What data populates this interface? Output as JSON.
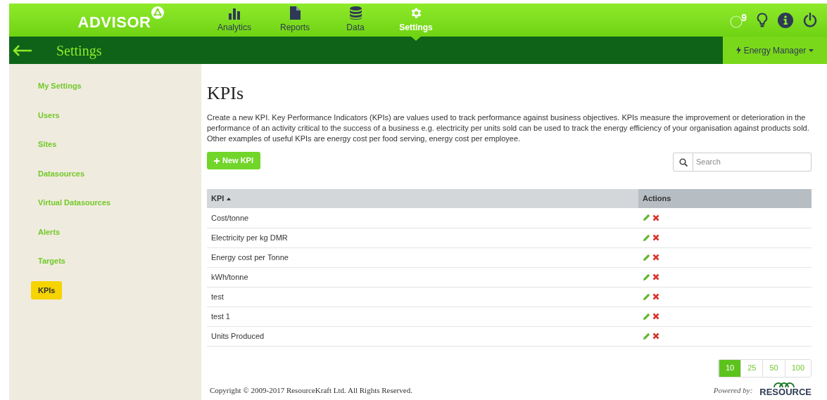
{
  "header": {
    "logo": "ADVISOR",
    "nav": [
      {
        "label": "Analytics",
        "selected": false
      },
      {
        "label": "Reports",
        "selected": false
      },
      {
        "label": "Data",
        "selected": false
      },
      {
        "label": "Settings",
        "selected": true
      }
    ],
    "badge": "9"
  },
  "subheader": {
    "title": "Settings",
    "role": "Energy Manager"
  },
  "sidebar": {
    "items": [
      {
        "label": "My Settings",
        "selected": false
      },
      {
        "label": "Users",
        "selected": false
      },
      {
        "label": "Sites",
        "selected": false
      },
      {
        "label": "Datasources",
        "selected": false
      },
      {
        "label": "Virtual Datasources",
        "selected": false
      },
      {
        "label": "Alerts",
        "selected": false
      },
      {
        "label": "Targets",
        "selected": false
      },
      {
        "label": "KPIs",
        "selected": true
      }
    ]
  },
  "page": {
    "title": "KPIs",
    "description": [
      "Create a new KPI. Key Performance Indicators (KPIs) are values used to track performance against business objectives. KPIs measure the improvement or deterioration in the performance of an activity critical to the success of a business e.g. electricity per units sold can be used to track the energy efficiency of your organisation against products sold.",
      "Other examples of useful KPIs are energy cost per food serving, energy cost per employee."
    ],
    "new_button": "New KPI",
    "search": {
      "placeholder": "Search"
    }
  },
  "table": {
    "columns": [
      "KPI",
      "Actions"
    ],
    "rows": [
      "Cost/tonne",
      "Electricity per kg DMR",
      "Energy cost per Tonne",
      "kWh/tonne",
      "test",
      "test 1",
      "Units Produced"
    ]
  },
  "page_sizes": [
    {
      "label": "10",
      "selected": true
    },
    {
      "label": "25",
      "selected": false
    },
    {
      "label": "50",
      "selected": false
    },
    {
      "label": "100",
      "selected": false
    }
  ],
  "footer": {
    "copyright": "Copyright © 2009-2017 ResourceKraft Ltd. All Rights Reserved.",
    "powered_by": "Powered by:",
    "brand": "RESOURCE"
  }
}
